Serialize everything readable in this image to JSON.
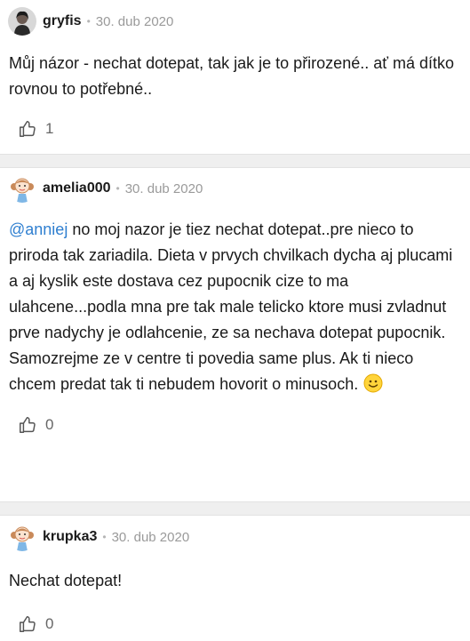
{
  "comments": [
    {
      "author": "gryfis",
      "date": "30. dub 2020",
      "text": "Můj názor - nechat dotepat, tak jak je to přirozené.. ať má dítko rovnou to potřebné..",
      "likes": "1",
      "avatar": "photo-avatar"
    },
    {
      "author": "amelia000",
      "date": "30. dub 2020",
      "mention": "@anniej",
      "text": " no moj nazor je tiez nechat dotepat..pre nieco to priroda tak zariadila. Dieta v prvych chvilkach dycha aj plucami a aj kyslik este dostava cez pupocnik cize to ma ulahcene...podla mna pre tak male telicko ktore musi zvladnut prve nadychy je odlahcenie, ze sa nechava dotepat pupocnik. Samozrejme ze v centre ti povedia same plus. Ak ti nieco chcem predat tak ti nebudem hovorit o minusoch.",
      "emoji": "smiley-icon",
      "likes": "0",
      "avatar": "cartoon-girl-avatar"
    },
    {
      "author": "krupka3",
      "date": "30. dub 2020",
      "text": "Nechat dotepat!",
      "likes": "0",
      "avatar": "cartoon-girl-avatar"
    }
  ],
  "colors": {
    "mention": "#2f7fd0",
    "separator": "#efefef",
    "date": "#9a9a9a"
  }
}
